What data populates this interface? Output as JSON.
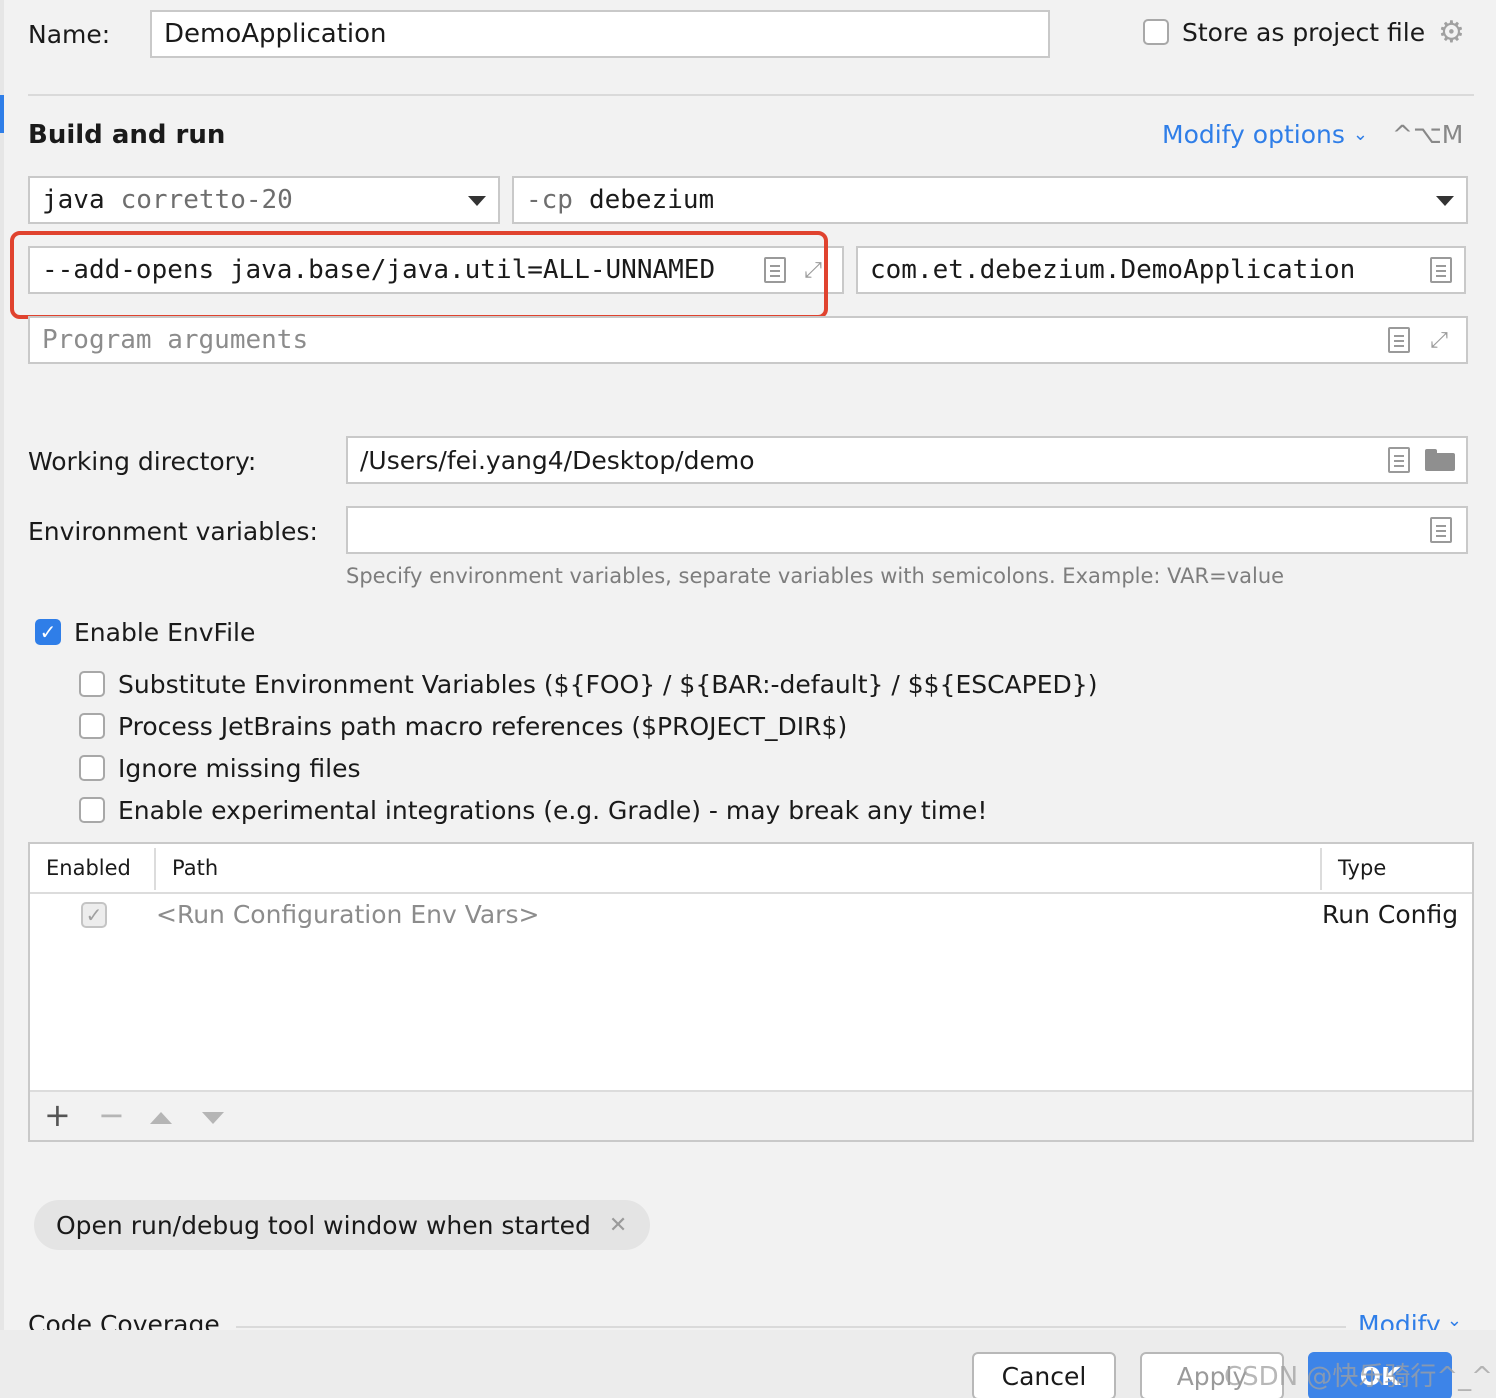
{
  "name_row": {
    "label": "Name:",
    "value": "DemoApplication",
    "store_label": "Store as project file"
  },
  "build_run": {
    "title": "Build and run",
    "modify_options": "Modify options",
    "shortcut": "^⌥M",
    "jdk_keyword": "java",
    "jdk_value": "corretto-20",
    "cp_keyword": "-cp",
    "cp_value": "debezium",
    "vm_options": "--add-opens java.base/java.util=ALL-UNNAMED",
    "main_class": "com.et.debezium.DemoApplication",
    "program_args_placeholder": "Program arguments"
  },
  "working_dir": {
    "label": "Working directory:",
    "value": "/Users/fei.yang4/Desktop/demo"
  },
  "env_vars": {
    "label": "Environment variables:",
    "value": "",
    "hint": "Specify environment variables, separate variables with semicolons. Example: VAR=value"
  },
  "envfile": {
    "enable_label": "Enable EnvFile",
    "options": [
      "Substitute Environment Variables (${FOO} / ${BAR:-default} / $${ESCAPED})",
      "Process JetBrains path macro references ($PROJECT_DIR$)",
      "Ignore missing files",
      "Enable experimental integrations (e.g. Gradle) - may break any time!"
    ],
    "table": {
      "headers": [
        "Enabled",
        "Path",
        "Type"
      ],
      "rows": [
        {
          "path": "<Run Configuration Env Vars>",
          "type": "Run Config"
        }
      ]
    }
  },
  "tag_chip": "Open run/debug tool window when started",
  "code_coverage": {
    "title": "Code Coverage",
    "modify": "Modify"
  },
  "footer": {
    "cancel": "Cancel",
    "apply": "Apply",
    "ok": "OK",
    "watermark": "CSDN @快乐骑行^_^"
  },
  "colors": {
    "accent": "#2f7ee8",
    "highlight": "#e0432f"
  }
}
